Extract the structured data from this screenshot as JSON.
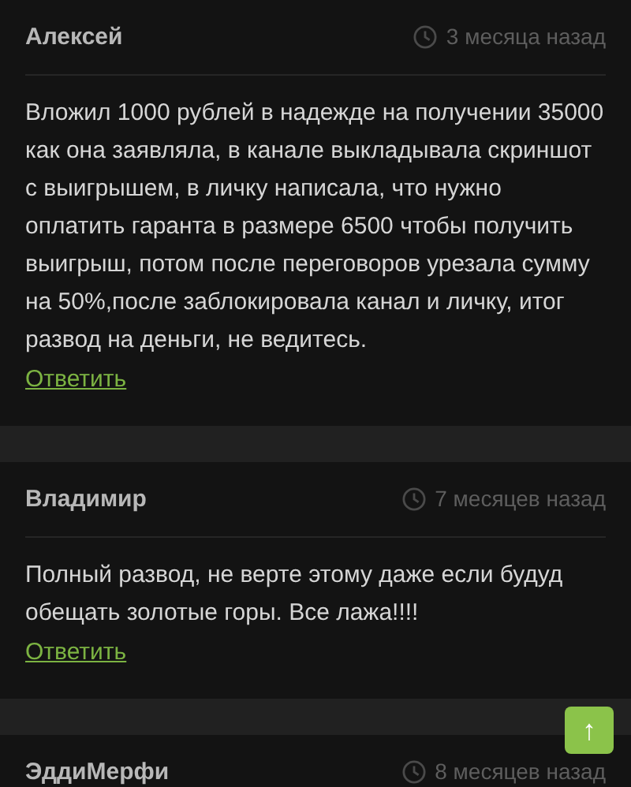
{
  "comments": [
    {
      "author": "Алексей",
      "time": "3 месяца назад",
      "text": "Вложил 1000 рублей в надежде на получении 35000 как она заявляла, в канале выкладывала скриншот с выигрышем, в личку написала, что нужно оплатить гаранта в размере 6500 чтобы получить выигрыш, потом после переговоров урезала сумму на 50%,после заблокировала канал и личку, итог развод на деньги, не ведитесь.",
      "reply": "Ответить"
    },
    {
      "author": "Владимир",
      "time": "7 месяцев назад",
      "text": "Полный развод, не верте этому даже если будуд обещать золотые горы. Все лажа!!!!",
      "reply": "Ответить"
    },
    {
      "author": "ЭддиМерфи",
      "time": "8 месяцев назад"
    }
  ],
  "scroll_top": {
    "label": "↑"
  }
}
